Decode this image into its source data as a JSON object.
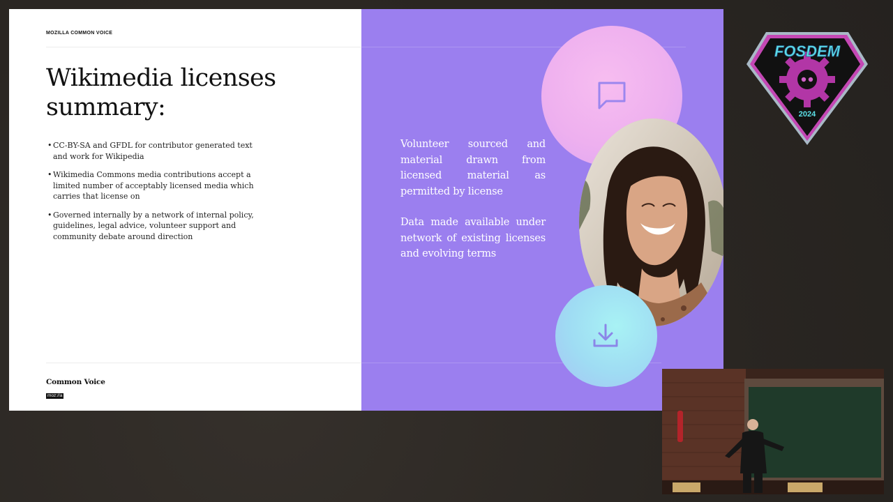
{
  "slide": {
    "brand_header": "MOZILLA COMMON VOICE",
    "title": "Wikimedia licenses summary:",
    "bullets": [
      "CC-BY-SA and GFDL for contributor generated text and work for Wikipedia",
      "Wikimedia Commons media contributions accept a limited number of acceptably licensed media which carries that license on",
      "Governed internally by a network of internal policy, guidelines, legal advice, volunteer support and community debate around direction"
    ],
    "bullet_marker": "•",
    "footer": {
      "logo_text": "Common Voice",
      "logo_badge": "moz://a"
    },
    "right_panel": {
      "paragraph_1": "Volunteer sourced and material drawn from licensed material as permitted by license",
      "paragraph_2": "Data made available under network of existing licenses and evolving terms",
      "accent_color": "#9b7fef",
      "icons": [
        "chat-bubble-icon",
        "download-icon"
      ]
    }
  },
  "event_badge": {
    "name": "FOSDEM",
    "year": "2024"
  },
  "camera_feed": {
    "description_icon": "speaker-video"
  }
}
